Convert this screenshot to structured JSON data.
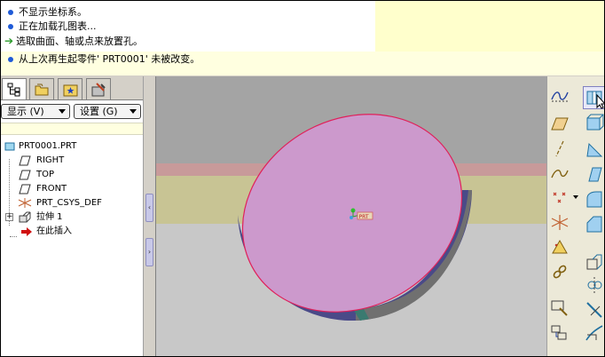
{
  "messages": [
    {
      "text": "不显示坐标系。",
      "marker": "bullet"
    },
    {
      "text": "正在加载孔图表...",
      "marker": "bullet"
    },
    {
      "text": "选取曲面、轴或点来放置孔。",
      "marker": "arrow"
    },
    {
      "text": "从上次再生起零件' PRT0001' 未被改变。",
      "marker": "bullet"
    }
  ],
  "panel": {
    "show_button": "显示 (V)",
    "settings_button": "设置 (G)"
  },
  "tree": {
    "root": "PRT0001.PRT",
    "items": [
      {
        "label": "RIGHT",
        "icon": "datum-plane-icon"
      },
      {
        "label": "TOP",
        "icon": "datum-plane-icon"
      },
      {
        "label": "FRONT",
        "icon": "datum-plane-icon"
      },
      {
        "label": "PRT_CSYS_DEF",
        "icon": "csys-icon"
      },
      {
        "label": "拉伸 1",
        "icon": "extrude-icon"
      },
      {
        "label": "在此插入",
        "icon": "insert-arrow-icon"
      }
    ]
  },
  "viewport": {
    "csys_label": "PRT"
  },
  "colors": {
    "message_bullet": "#1e5ad7",
    "arrow_green": "#2a9a2a",
    "disk_face": "#cc99cc",
    "disk_edge": "#e0205a",
    "insert_arrow": "#d01010",
    "feature_icon": "#d08020"
  }
}
